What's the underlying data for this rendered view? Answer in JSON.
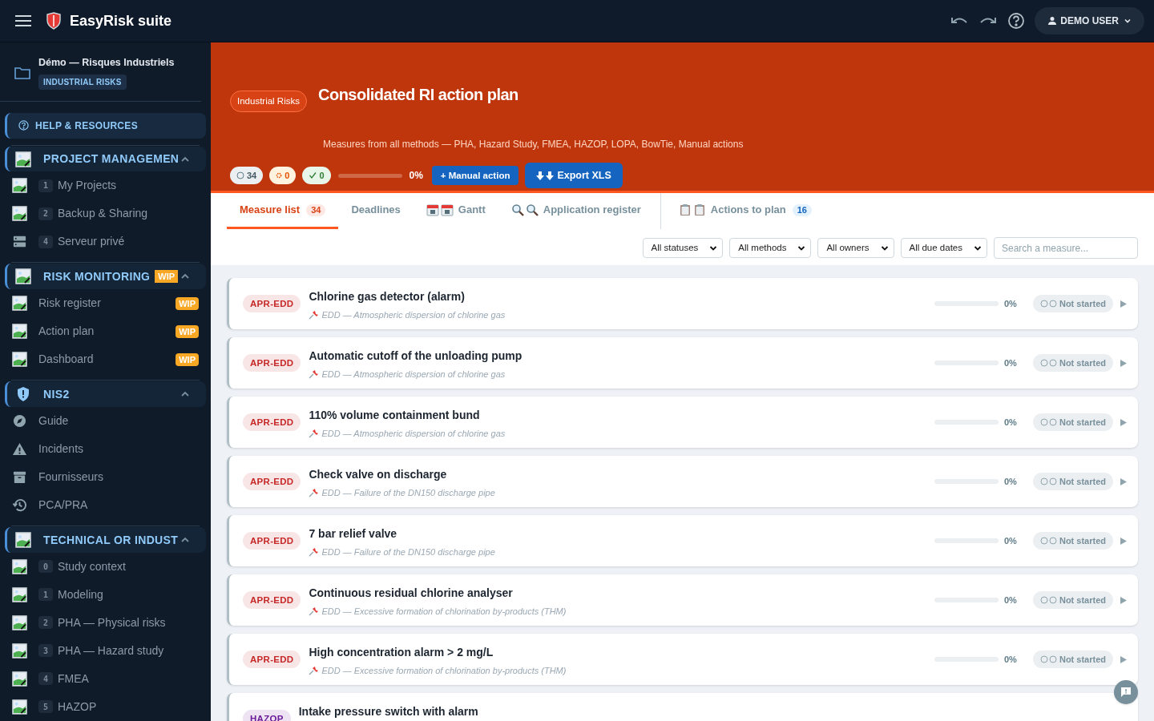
{
  "app": {
    "title": "EasyRisk suite",
    "user": "DEMO USER"
  },
  "project": {
    "name": "Démo — Risques Industriels",
    "tag": "INDUSTRIAL RISKS"
  },
  "help": {
    "label": "HELP & RESOURCES"
  },
  "sidebar_sections": [
    {
      "title": "PROJECT MANAGEMEN",
      "kind": "image",
      "expanded": true,
      "items": [
        {
          "number": "1",
          "label": "My Projects",
          "kind": "image"
        },
        {
          "number": "2",
          "label": "Backup & Sharing",
          "kind": "image"
        },
        {
          "number": "4",
          "label": "Serveur privé",
          "kind": "server"
        }
      ]
    },
    {
      "title": "RISK MONITORING",
      "badge": "WIP",
      "kind": "image",
      "expanded": true,
      "items": [
        {
          "label": "Risk register",
          "kind": "image",
          "badge": "WIP"
        },
        {
          "label": "Action plan",
          "kind": "image",
          "badge": "WIP"
        },
        {
          "label": "Dashboard",
          "kind": "image",
          "badge": "WIP"
        }
      ]
    },
    {
      "title": "NIS2",
      "kind": "shield",
      "expanded": true,
      "items": [
        {
          "label": "Guide",
          "kind": "compass"
        },
        {
          "label": "Incidents",
          "kind": "warning"
        },
        {
          "label": "Fournisseurs",
          "kind": "archive"
        },
        {
          "label": "PCA/PRA",
          "kind": "history"
        }
      ]
    },
    {
      "title": "TECHNICAL OR INDUST",
      "kind": "image",
      "expanded": true,
      "items": [
        {
          "number": "0",
          "label": "Study context",
          "kind": "image"
        },
        {
          "number": "1",
          "label": "Modeling",
          "kind": "image"
        },
        {
          "number": "2",
          "label": "PHA — Physical risks",
          "kind": "image"
        },
        {
          "number": "3",
          "label": "PHA — Hazard study",
          "kind": "image"
        },
        {
          "number": "4",
          "label": "FMEA",
          "kind": "image"
        },
        {
          "number": "5",
          "label": "HAZOP",
          "kind": "image"
        }
      ]
    }
  ],
  "header": {
    "tag": "Industrial Risks",
    "title": "Consolidated RI action plan",
    "subtitle": "Measures from all methods — PHA, Hazard Study, FMEA, HAZOP, LOPA, BowTie, Manual actions",
    "stats": [
      {
        "kind": "open",
        "value": "34"
      },
      {
        "kind": "in_progress",
        "value": "0"
      },
      {
        "kind": "done",
        "value": "0"
      }
    ],
    "progress": {
      "level": 0,
      "reading": "0%"
    },
    "buttons": [
      {
        "kind": "add",
        "label": "+ Manual action"
      },
      {
        "kind": "export",
        "label": "Export XLS"
      }
    ]
  },
  "tabs": [
    {
      "label": "Measure list",
      "count": "34",
      "selected": true
    },
    {
      "label": "Deadlines",
      "selected": false
    },
    {
      "label": "Gantt",
      "kind": "calendar",
      "selected": false
    },
    {
      "label": "Application register",
      "kind": "search",
      "selected": false
    },
    {
      "label": "Actions to plan",
      "kind": "clipboard",
      "count": "16",
      "separated": true,
      "selected": false
    }
  ],
  "filters": {
    "selects": [
      "All statuses",
      "All methods",
      "All owners",
      "All due dates"
    ],
    "search": {
      "placeholder": "Search a measure..."
    }
  },
  "measures": [
    {
      "code": "APR-EDD",
      "color": "#c62828",
      "title": "Chlorine gas detector (alarm)",
      "source": "EDD — Atmospheric dispersion of chlorine gas",
      "level": 0,
      "reading": "0%",
      "status": "Not started"
    },
    {
      "code": "APR-EDD",
      "color": "#c62828",
      "title": "Automatic cutoff of the unloading pump",
      "source": "EDD — Atmospheric dispersion of chlorine gas",
      "level": 0,
      "reading": "0%",
      "status": "Not started"
    },
    {
      "code": "APR-EDD",
      "color": "#c62828",
      "title": "110% volume containment bund",
      "source": "EDD — Atmospheric dispersion of chlorine gas",
      "level": 0,
      "reading": "0%",
      "status": "Not started"
    },
    {
      "code": "APR-EDD",
      "color": "#c62828",
      "title": "Check valve on discharge",
      "source": "EDD — Failure of the DN150 discharge pipe",
      "level": 0,
      "reading": "0%",
      "status": "Not started"
    },
    {
      "code": "APR-EDD",
      "color": "#c62828",
      "title": "7 bar relief valve",
      "source": "EDD — Failure of the DN150 discharge pipe",
      "level": 0,
      "reading": "0%",
      "status": "Not started"
    },
    {
      "code": "APR-EDD",
      "color": "#c62828",
      "title": "Continuous residual chlorine analyser",
      "source": "EDD — Excessive formation of chlorination by-products (THM)",
      "level": 0,
      "reading": "0%",
      "status": "Not started"
    },
    {
      "code": "APR-EDD",
      "color": "#c62828",
      "title": "High concentration alarm > 2 mg/L",
      "source": "EDD — Excessive formation of chlorination by-products (THM)",
      "level": 0,
      "reading": "0%",
      "status": "Not started"
    },
    {
      "code": "HAZOP",
      "color": "#6a1b9a",
      "title": "Intake pressure switch with alarm"
    }
  ]
}
